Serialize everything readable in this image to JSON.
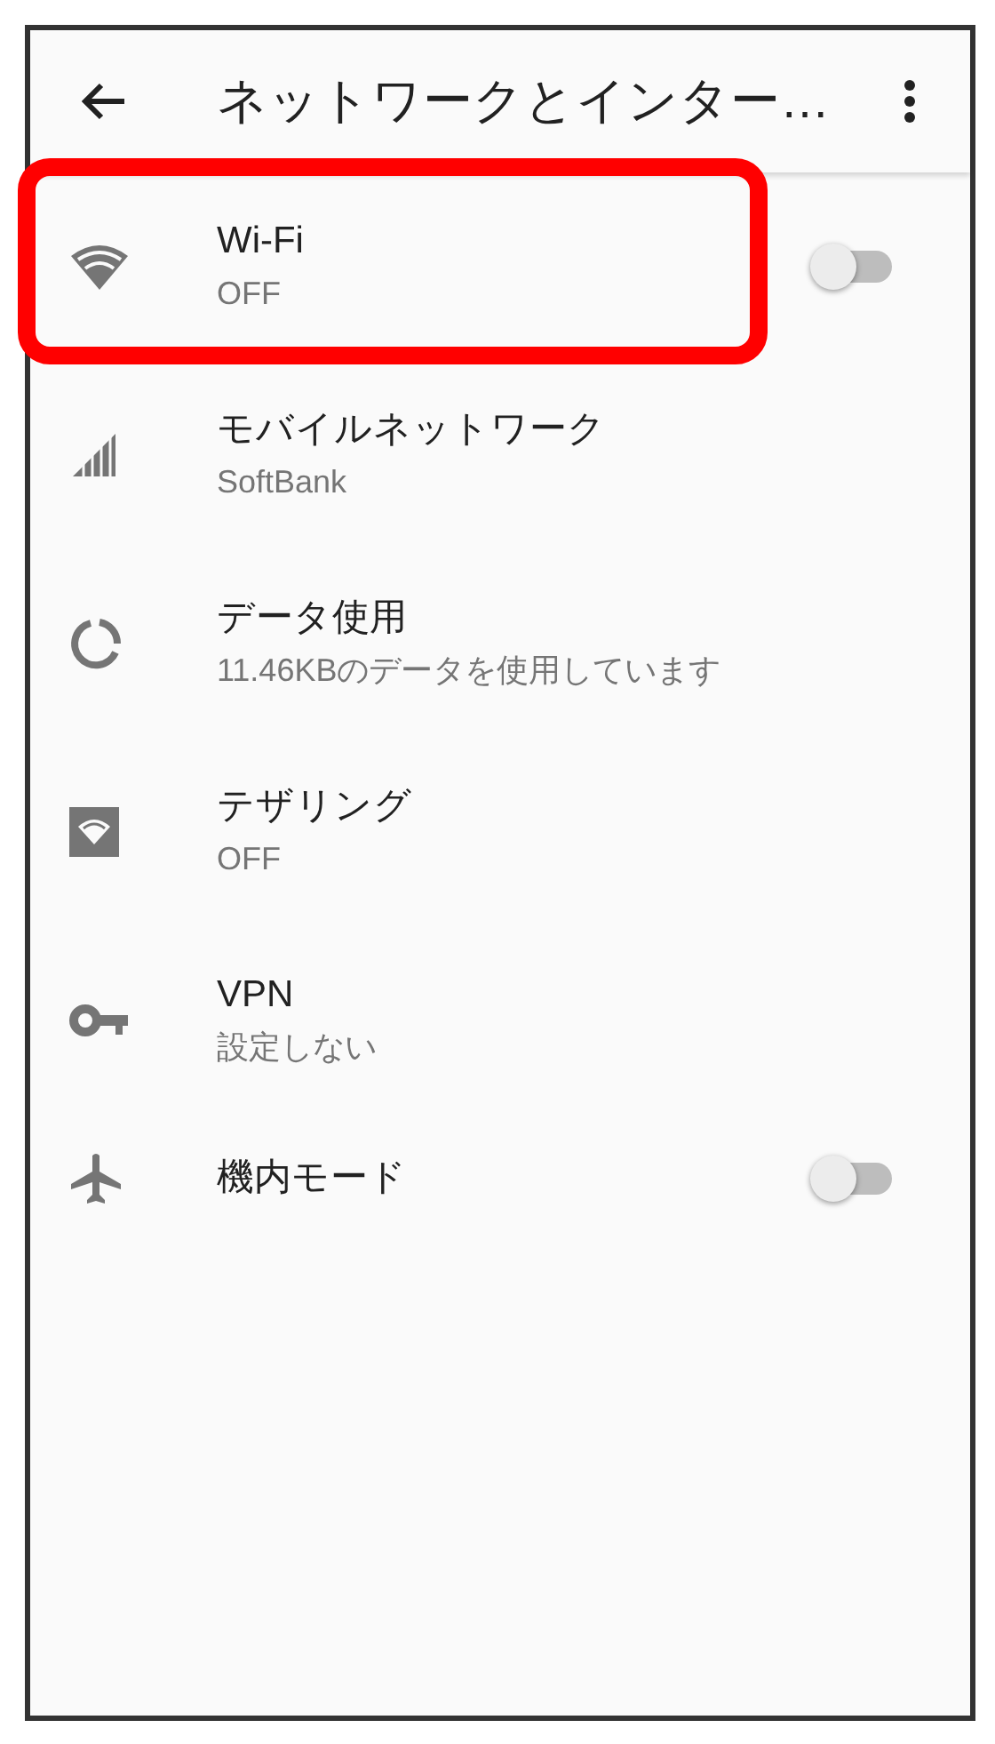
{
  "app_bar": {
    "title": "ネットワークとインター…"
  },
  "items": [
    {
      "kind": "wifi",
      "title": "Wi-Fi",
      "summary": "OFF",
      "toggle": {
        "on": false
      },
      "highlighted": true
    },
    {
      "kind": "signal",
      "title": "モバイルネットワーク",
      "summary": "SoftBank",
      "highlighted": false
    },
    {
      "kind": "data",
      "title": "データ使用",
      "summary": "11.46KBのデータを使用しています",
      "highlighted": false
    },
    {
      "kind": "hotspot",
      "title": "テザリング",
      "summary": "OFF",
      "highlighted": false
    },
    {
      "kind": "key",
      "title": "VPN",
      "summary": "設定しない",
      "highlighted": false
    },
    {
      "kind": "airplane",
      "title": "機内モード",
      "toggle": {
        "on": false
      },
      "highlighted": false
    }
  ]
}
